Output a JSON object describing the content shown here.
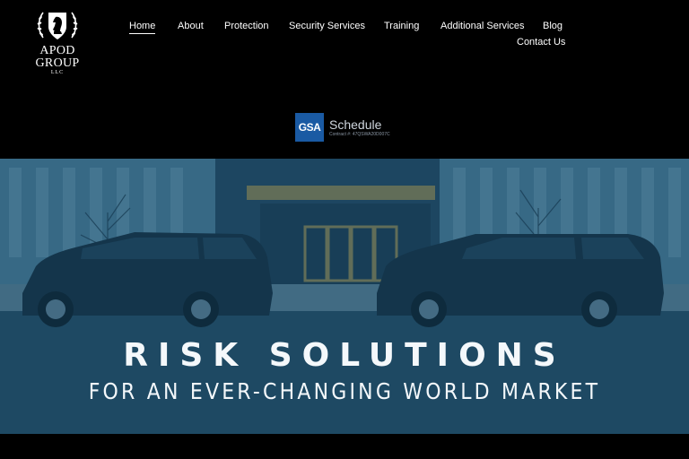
{
  "brand": {
    "name": "APOD GROUP",
    "suffix": "LLC",
    "logo_icon": "knight-crest-icon"
  },
  "nav": {
    "items": [
      {
        "label": "Home",
        "active": true
      },
      {
        "label": "About"
      },
      {
        "label": "Protection"
      },
      {
        "label": "Security Services"
      },
      {
        "label": "Training"
      },
      {
        "label": "Additional Services"
      },
      {
        "label": "Blog"
      },
      {
        "label": "Contact Us"
      }
    ]
  },
  "gsa": {
    "logo_text": "GSA",
    "schedule_label": "Schedule",
    "contract_text": "Contract #: 47QSWA20D007C"
  },
  "hero": {
    "headline": "RISK SOLUTIONS",
    "subheadline": "FOR AN EVER-CHANGING WORLD MARKET",
    "overlay_color": "#1f4a66"
  },
  "colors": {
    "background": "#000000",
    "text": "#ffffff",
    "gsa_blue": "#1a5aa3"
  }
}
